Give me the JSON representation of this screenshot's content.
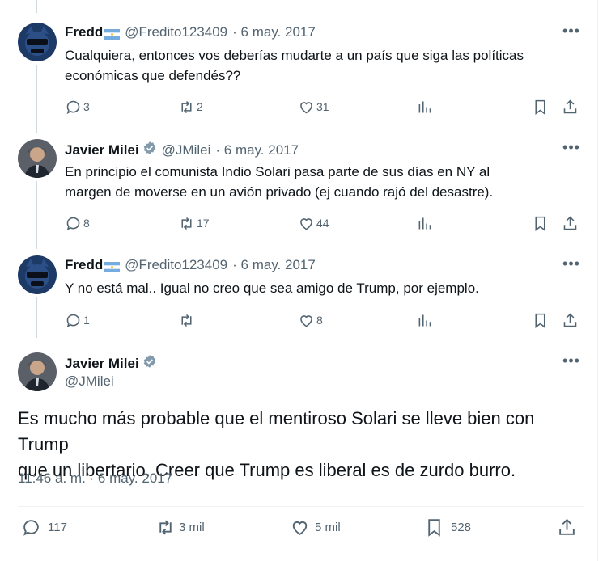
{
  "colors": {
    "text": "#0f1419",
    "secondary": "#536471",
    "verified": "#829aab",
    "thread_line": "#cfd9de"
  },
  "tweets": [
    {
      "name": "Fredd",
      "handle": "@Fredito123409",
      "time": "· 6 may. 2017",
      "avatar": "cat-avatar",
      "has_flag": true,
      "text_lines": [
        "Cualquiera, entonces vos deberías mudarte a un país que siga las políticas",
        "económicas que defendés??"
      ],
      "replies": "3",
      "retweets": "2",
      "likes": "31"
    },
    {
      "name": "Javier Milei",
      "handle": "@JMilei",
      "time": "· 6 may. 2017",
      "avatar": "portrait-avatar",
      "verified": true,
      "text_lines": [
        "En principio el comunista Indio Solari pasa parte de sus días en NY al",
        "margen de moverse en un avión privado (ej cuando rajó del desastre)."
      ],
      "replies": "8",
      "retweets": "17",
      "likes": "44"
    },
    {
      "name": "Fredd",
      "handle": "@Fredito123409",
      "time": "· 6 may. 2017",
      "avatar": "cat-avatar",
      "has_flag": true,
      "text_lines": [
        "Y no está mal.. Igual no creo que sea amigo de Trump, por ejemplo."
      ],
      "replies": "1",
      "retweets": "",
      "likes": "8"
    }
  ],
  "main_tweet": {
    "name": "Javier Milei",
    "handle": "@JMilei",
    "text_lines": [
      "Es mucho más probable que el mentiroso Solari se lleve bien con Trump",
      "que un libertario. Creer que Trump es liberal es de zurdo burro."
    ],
    "timestamp": "11:46 a. m. · 6 may. 2017",
    "replies": "117",
    "retweets": "3 mil",
    "likes": "5 mil",
    "bookmarks": "528"
  },
  "icons": {
    "reply": "reply-icon",
    "retweet": "retweet-icon",
    "like": "heart-icon",
    "views": "views-icon",
    "bookmark": "bookmark-icon",
    "share": "share-icon",
    "more": "more-icon",
    "verified": "verified-badge-icon",
    "flag": "argentina-flag-icon"
  }
}
